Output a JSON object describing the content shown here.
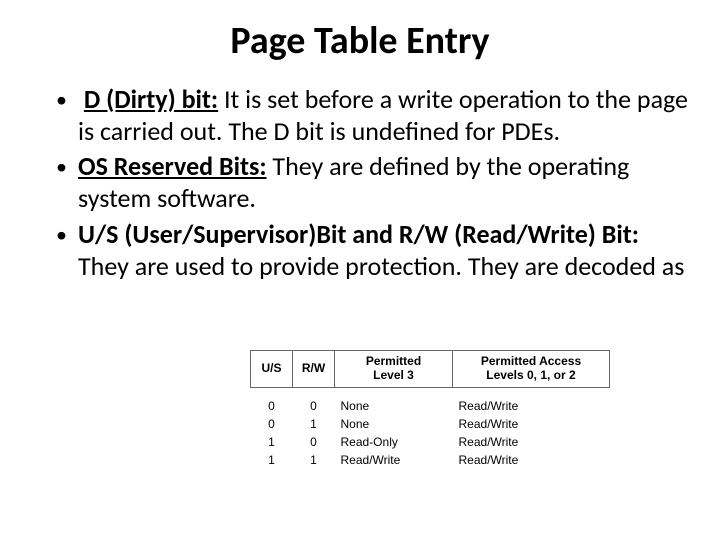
{
  "title": "Page Table Entry",
  "bullets": [
    {
      "label": "D (Dirty) bit:",
      "text": " It is set before a write operation to the page is carried out. The D bit is undefined for PDEs.",
      "leadspace": " "
    },
    {
      "label": "OS Reserved Bits:",
      "text": " They are defined by the operating system software.",
      "leadspace": ""
    },
    {
      "label": "U/S (User/Supervisor)Bit and R/W (Read/Write) Bit:",
      "text": " They are used to provide protection. They are decoded as",
      "leadspace": ""
    }
  ],
  "table": {
    "headers": {
      "us": "U/S",
      "rw": "R/W",
      "p3a": "Permitted",
      "p3b": "Level 3",
      "paa": "Permitted Access",
      "pab": "Levels 0, 1, or 2"
    },
    "rows": [
      {
        "us": "0",
        "rw": "0",
        "p3": "None",
        "pa": "Read/Write"
      },
      {
        "us": "0",
        "rw": "1",
        "p3": "None",
        "pa": "Read/Write"
      },
      {
        "us": "1",
        "rw": "0",
        "p3": "Read-Only",
        "pa": "Read/Write"
      },
      {
        "us": "1",
        "rw": "1",
        "p3": "Read/Write",
        "pa": "Read/Write"
      }
    ]
  }
}
